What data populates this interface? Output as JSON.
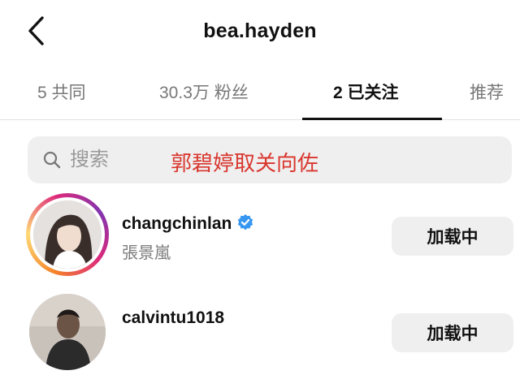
{
  "header": {
    "title": "bea.hayden"
  },
  "tabs": [
    {
      "label": "5 共同"
    },
    {
      "label": "30.3万 粉丝"
    },
    {
      "label": "2 已关注"
    },
    {
      "label": "推荐"
    }
  ],
  "search": {
    "placeholder": "搜索"
  },
  "overlay_caption": "郭碧婷取关向佐",
  "following": [
    {
      "username": "changchinlan",
      "full_name": "張景嵐",
      "verified": true,
      "button_label": "加载中"
    },
    {
      "username": "calvintu1018",
      "full_name": "",
      "verified": false,
      "button_label": "加载中"
    }
  ],
  "colors": {
    "caption": "#d9362d",
    "verified_badge": "#3897f0",
    "button_bg": "#efefef",
    "tab_active": "#111111",
    "tab_inactive": "#777777"
  }
}
